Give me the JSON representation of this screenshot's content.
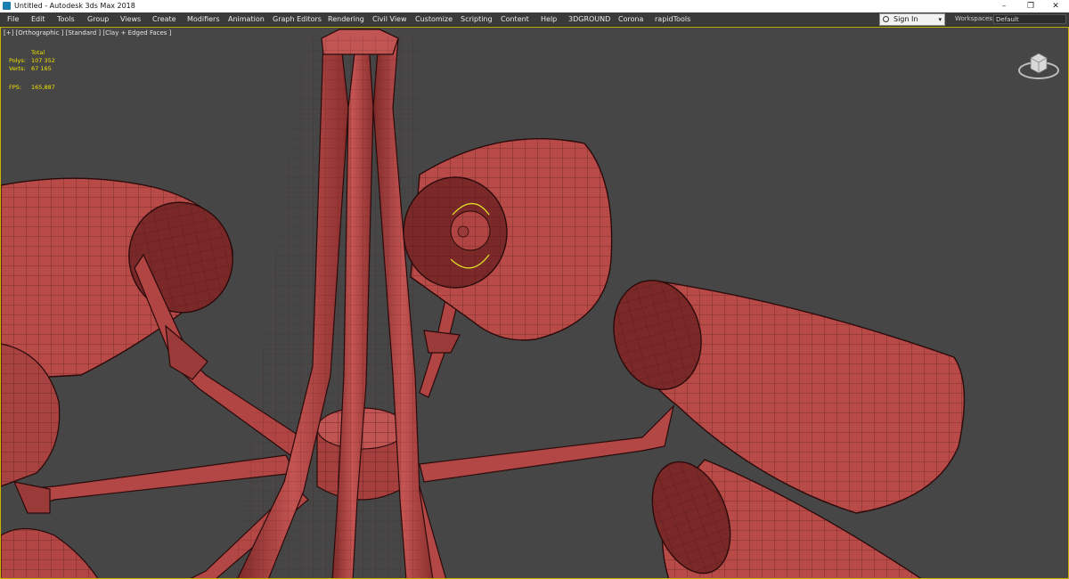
{
  "window": {
    "title": "Untitled - Autodesk 3ds Max 2018",
    "minimize": "–",
    "restore": "❐",
    "close": "✕"
  },
  "menu": [
    "File",
    "Edit",
    "Tools",
    "Group",
    "Views",
    "Create",
    "Modifiers",
    "Animation",
    "Graph Editors",
    "Rendering",
    "Civil View",
    "Customize",
    "Scripting",
    "Content",
    "Help",
    "3DGROUND",
    "Corona",
    "rapidTools"
  ],
  "signin": {
    "label": "Sign In",
    "dropdown": "▾"
  },
  "workspaces": {
    "label": "Workspaces:",
    "value": "Default"
  },
  "viewport": {
    "label": "[+] [Orthographic ] [Standard ] [Clay + Edged Faces ]",
    "stats": {
      "header": "Total",
      "polys_label": "Polys:",
      "polys_value": "107 352",
      "verts_label": "Verts:",
      "verts_value": "67 165",
      "fps_label": "FPS:",
      "fps_value": "165,887"
    }
  },
  "colors": {
    "clay": "#b84a48",
    "wire": "#3a1010",
    "viewport_bg": "#464646",
    "stats": "#f0e000",
    "selection_gizmo": "#e6e62a"
  },
  "icons": {
    "app": "3ds-max-icon",
    "viewcube": "viewcube-icon",
    "user": "user-icon"
  }
}
